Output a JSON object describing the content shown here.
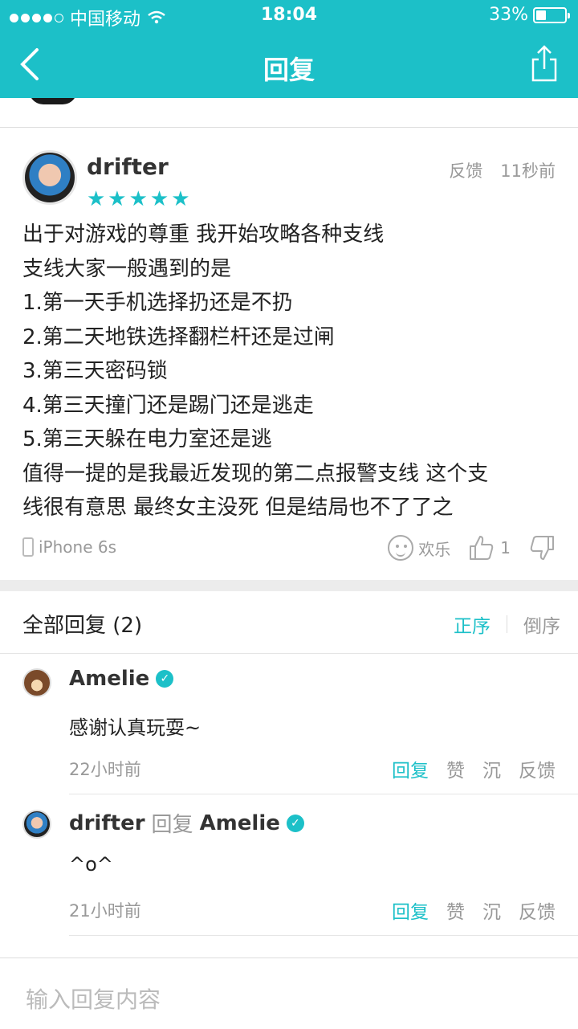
{
  "status": {
    "carrier": "中国移动",
    "time": "18:04",
    "battery": "33%"
  },
  "nav": {
    "title": "回复"
  },
  "post": {
    "username": "drifter",
    "rating": "★★★★★",
    "feedback_label": "反馈",
    "time": "11秒前",
    "body": [
      "出于对游戏的尊重 我开始攻略各种支线",
      "支线大家一般遇到的是",
      "1.第一天手机选择扔还是不扔",
      "2.第二天地铁选择翻栏杆还是过闸",
      "3.第三天密码锁",
      "4.第三天撞门还是踢门还是逃走",
      "5.第三天躲在电力室还是逃",
      "值得一提的是我最近发现的第二点报警支线 这个支",
      "线很有意思 最终女主没死 但是结局也不了了之"
    ],
    "device": "iPhone 6s",
    "mood": "欢乐",
    "likes": "1"
  },
  "replies": {
    "label": "全部回复 (2)",
    "sort_asc": "正序",
    "sort_desc": "倒序",
    "items": [
      {
        "name": "Amelie",
        "text": "感谢认真玩耍~",
        "time": "22小时前",
        "reply": "回复",
        "like": "赞",
        "sink": "沉",
        "feedback": "反馈"
      },
      {
        "name": "drifter",
        "reply_word": "回复",
        "reply_to": "Amelie",
        "text": "^o^",
        "time": "21小时前",
        "reply": "回复",
        "like": "赞",
        "sink": "沉",
        "feedback": "反馈"
      }
    ]
  },
  "input": {
    "placeholder": "输入回复内容"
  },
  "colors": {
    "accent": "#1cc0c8"
  }
}
